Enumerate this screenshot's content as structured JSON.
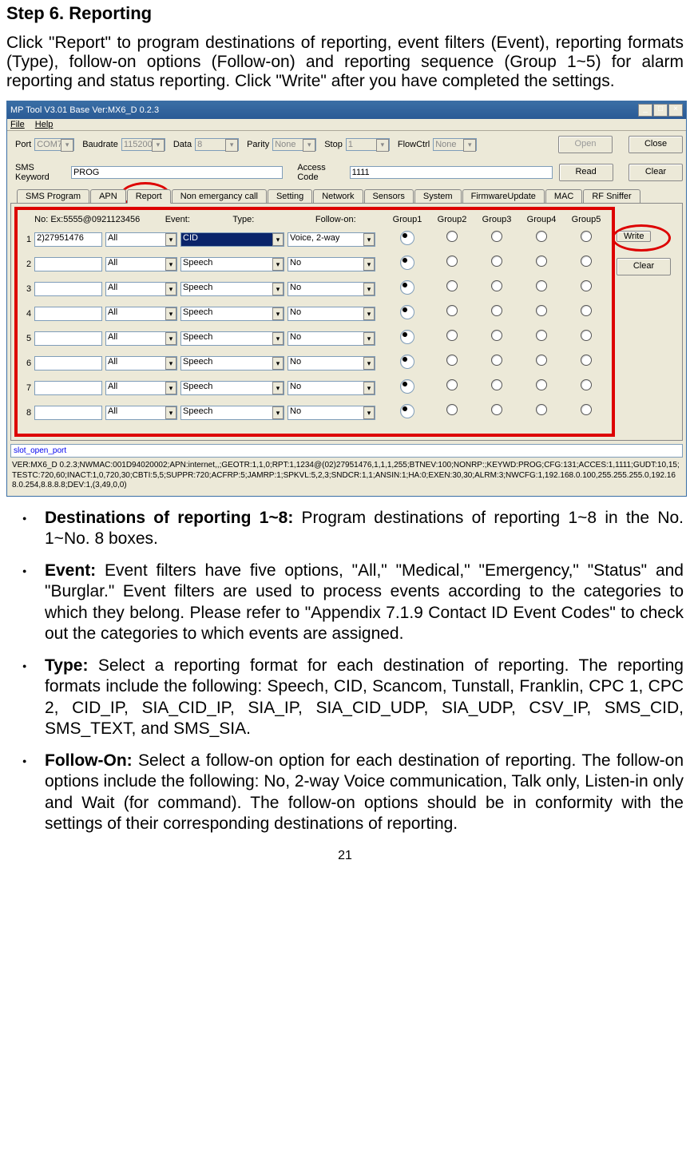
{
  "doc": {
    "step_title": "Step 6. Reporting",
    "intro": "Click \"Report\" to program destinations of reporting, event filters (Event), reporting formats (Type), follow-on options (Follow-on) and reporting sequence (Group 1~5) for alarm reporting and status reporting. Click \"Write\" after you have completed the settings.",
    "bullets": [
      {
        "term": "Destinations of reporting 1~8:",
        "text": " Program destinations of reporting 1~8 in the No. 1~No. 8 boxes."
      },
      {
        "term": "Event:",
        "text": " Event filters have five options, \"All,\" \"Medical,\" \"Emergency,\" \"Status\" and \"Burglar.\" Event filters are used to process events according to the categories to which they belong. Please refer to \"Appendix 7.1.9 Contact ID Event Codes\" to check out the categories to which events are assigned."
      },
      {
        "term": "Type:",
        "text": " Select a reporting format for each destination of reporting. The reporting formats include the following: Speech, CID, Scancom, Tunstall, Franklin, CPC 1, CPC 2, CID_IP, SIA_CID_IP, SIA_IP, SIA_CID_UDP, SIA_UDP, CSV_IP, SMS_CID, SMS_TEXT, and SMS_SIA."
      },
      {
        "term": "Follow-On:",
        "text": " Select a follow-on option for each destination of reporting. The follow-on options include the following: No, 2-way Voice communication, Talk only, Listen-in only and Wait (for command). The follow-on options should be in conformity with the settings of their corresponding destinations of reporting."
      }
    ],
    "page": "21"
  },
  "app": {
    "title": "MP Tool V3.01  Base Ver:MX6_D 0.2.3",
    "menu": {
      "file": "File",
      "help": "Help"
    },
    "conn": {
      "port_lbl": "Port",
      "port": "COM7",
      "baud_lbl": "Baudrate",
      "baud": "115200",
      "data_lbl": "Data",
      "data": "8",
      "parity_lbl": "Parity",
      "parity": "None",
      "stop_lbl": "Stop",
      "stop": "1",
      "flow_lbl": "FlowCtrl",
      "flow": "None",
      "open": "Open",
      "close": "Close"
    },
    "sms": {
      "kw_lbl": "SMS Keyword",
      "kw": "PROG",
      "ac_lbl": "Access Code",
      "ac": "1111",
      "read": "Read",
      "clear": "Clear"
    },
    "tabs": [
      "SMS Program",
      "APN",
      "Report",
      "Non emergancy call",
      "Setting",
      "Network",
      "Sensors",
      "System",
      "FirmwareUpdate",
      "MAC",
      "RF Sniffer"
    ],
    "active_tab": 2,
    "report": {
      "hdr": {
        "no": "No: Ex:5555@0921123456",
        "event": "Event:",
        "type": "Type:",
        "follow": "Follow-on:",
        "g1": "Group1",
        "g2": "Group2",
        "g3": "Group3",
        "g4": "Group4",
        "g5": "Group5"
      },
      "rows": [
        {
          "n": "1",
          "dest": "2)27951476",
          "event": "All",
          "type": "CID",
          "type_hl": true,
          "follow": "Voice, 2-way",
          "grp": 1
        },
        {
          "n": "2",
          "dest": "",
          "event": "All",
          "type": "Speech",
          "type_hl": false,
          "follow": "No",
          "grp": 1
        },
        {
          "n": "3",
          "dest": "",
          "event": "All",
          "type": "Speech",
          "type_hl": false,
          "follow": "No",
          "grp": 1
        },
        {
          "n": "4",
          "dest": "",
          "event": "All",
          "type": "Speech",
          "type_hl": false,
          "follow": "No",
          "grp": 1
        },
        {
          "n": "5",
          "dest": "",
          "event": "All",
          "type": "Speech",
          "type_hl": false,
          "follow": "No",
          "grp": 1
        },
        {
          "n": "6",
          "dest": "",
          "event": "All",
          "type": "Speech",
          "type_hl": false,
          "follow": "No",
          "grp": 1
        },
        {
          "n": "7",
          "dest": "",
          "event": "All",
          "type": "Speech",
          "type_hl": false,
          "follow": "No",
          "grp": 1
        },
        {
          "n": "8",
          "dest": "",
          "event": "All",
          "type": "Speech",
          "type_hl": false,
          "follow": "No",
          "grp": 1
        }
      ],
      "write": "Write",
      "clear": "Clear"
    },
    "status": "slot_open_port",
    "ver": "VER:MX6_D 0.2.3;NWMAC:001D94020002;APN:internet,,;GEOTR:1,1,0;RPT:1,1234@(02)27951476,1,1,1,255;BTNEV:100;NONRP:;KEYWD:PROG;CFG:131;ACCES:1,1111;GUDT:10,15;TESTC:720,60;INACT:1,0,720,30;CBTI:5,5;SUPPR:720;ACFRP:5;JAMRP:1;SPKVL:5,2,3;SNDCR:1,1;ANSIN:1;HA:0;EXEN:30,30;ALRM:3;NWCFG:1,192.168.0.100,255.255.255.0,192.168.0.254,8.8.8.8;DEV:1,(3,49,0,0)"
  }
}
